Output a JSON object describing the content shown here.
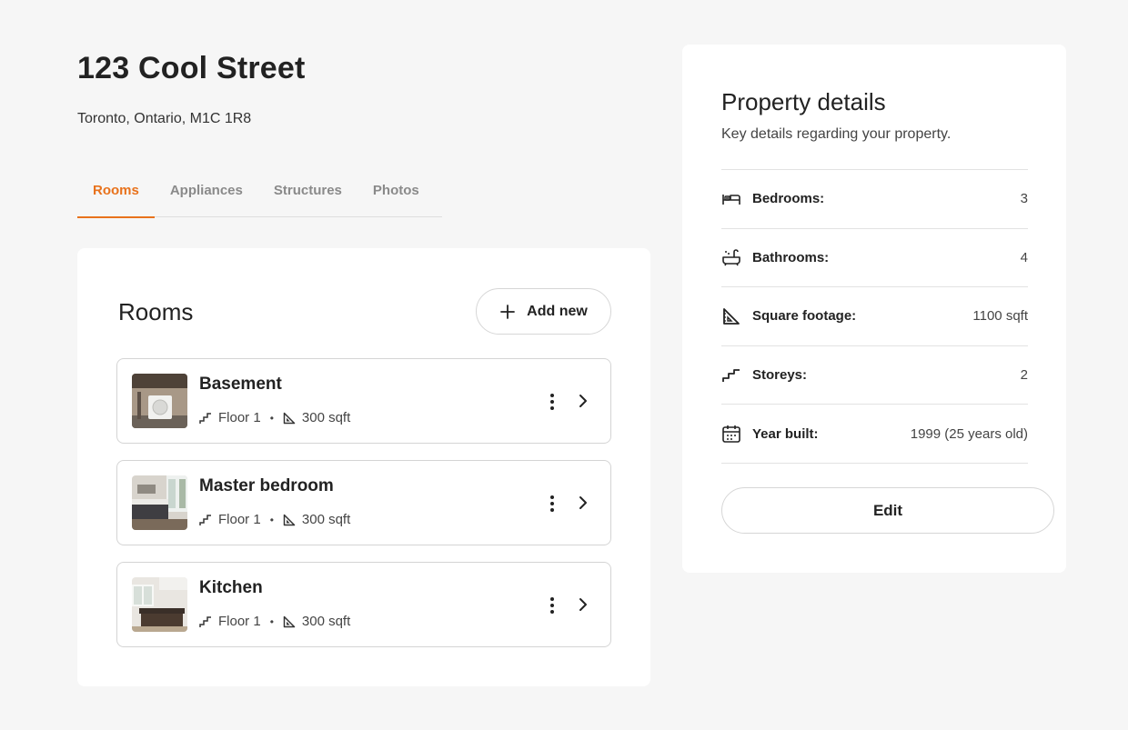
{
  "header": {
    "title": "123 Cool Street",
    "subtitle": "Toronto, Ontario, M1C 1R8"
  },
  "tabs": [
    {
      "label": "Rooms",
      "active": true
    },
    {
      "label": "Appliances",
      "active": false
    },
    {
      "label": "Structures",
      "active": false
    },
    {
      "label": "Photos",
      "active": false
    }
  ],
  "rooms": {
    "title": "Rooms",
    "add_label": "Add new",
    "items": [
      {
        "name": "Basement",
        "floor": "Floor 1",
        "area": "300 sqft",
        "thumb_icon": "basement-photo"
      },
      {
        "name": "Master bedroom",
        "floor": "Floor 1",
        "area": "300 sqft",
        "thumb_icon": "bedroom-photo"
      },
      {
        "name": "Kitchen",
        "floor": "Floor 1",
        "area": "300 sqft",
        "thumb_icon": "kitchen-photo"
      }
    ]
  },
  "details": {
    "title": "Property details",
    "subtitle": "Key details regarding your property.",
    "rows": [
      {
        "icon": "bed-icon",
        "label": "Bedrooms:",
        "value": "3"
      },
      {
        "icon": "bathtub-icon",
        "label": "Bathrooms:",
        "value": "4"
      },
      {
        "icon": "ruler-triangle-icon",
        "label": "Square footage:",
        "value": "1100 sqft"
      },
      {
        "icon": "stairs-icon",
        "label": "Storeys:",
        "value": "2"
      },
      {
        "icon": "calendar-icon",
        "label": "Year built:",
        "value": "1999 (25 years old)"
      }
    ],
    "edit_label": "Edit"
  },
  "colors": {
    "accent": "#e8721c",
    "background": "#f6f6f6",
    "card": "#ffffff",
    "border": "#d4d4d4"
  }
}
